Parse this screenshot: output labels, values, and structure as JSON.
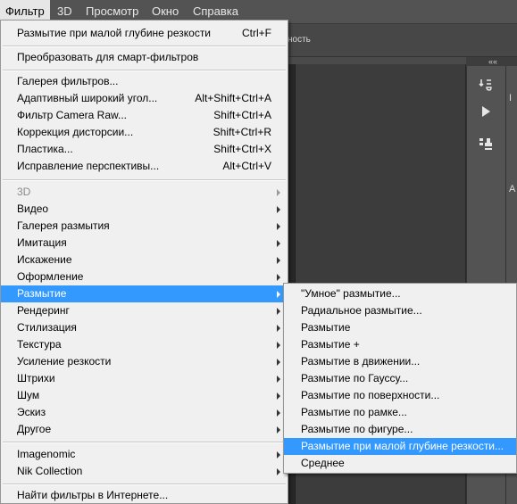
{
  "menubar": {
    "items": [
      "Фильтр",
      "3D",
      "Просмотр",
      "Окно",
      "Справка"
    ]
  },
  "optionsbar": {
    "partial_text": "ность"
  },
  "dock": {
    "header": "««",
    "tools": [
      "history-brush-icon",
      "play-icon",
      "clone-source-icon"
    ],
    "mini_labels": [
      "I",
      "A"
    ]
  },
  "filter_menu": {
    "last_filter": {
      "label": "Размытие при малой глубине резкости",
      "shortcut": "Ctrl+F"
    },
    "smart": "Преобразовать для смарт-фильтров",
    "group1": [
      {
        "label": "Галерея фильтров...",
        "shortcut": ""
      },
      {
        "label": "Адаптивный широкий угол...",
        "shortcut": "Alt+Shift+Ctrl+A"
      },
      {
        "label": "Фильтр Camera Raw...",
        "shortcut": "Shift+Ctrl+A"
      },
      {
        "label": "Коррекция дисторсии...",
        "shortcut": "Shift+Ctrl+R"
      },
      {
        "label": "Пластика...",
        "shortcut": "Shift+Ctrl+X"
      },
      {
        "label": "Исправление перспективы...",
        "shortcut": "Alt+Ctrl+V"
      }
    ],
    "submenus": [
      "3D",
      "Видео",
      "Галерея размытия",
      "Имитация",
      "Искажение",
      "Оформление",
      "Размытие",
      "Рендеринг",
      "Стилизация",
      "Текстура",
      "Усиление резкости",
      "Штрихи",
      "Шум",
      "Эскиз",
      "Другое"
    ],
    "plugins": [
      "Imagenomic",
      "Nik Collection"
    ],
    "online": "Найти фильтры в Интернете..."
  },
  "blur_submenu": {
    "items": [
      "\"Умное\" размытие...",
      "Радиальное размытие...",
      "Размытие",
      "Размытие +",
      "Размытие в движении...",
      "Размытие по Гауссу...",
      "Размытие по поверхности...",
      "Размытие по рамке...",
      "Размытие по фигуре...",
      "Размытие при малой глубине резкости...",
      "Среднее"
    ]
  },
  "colors": {
    "highlight": "#3399ff",
    "menu_bg": "#f0f0f0",
    "app_bg": "#535353"
  }
}
